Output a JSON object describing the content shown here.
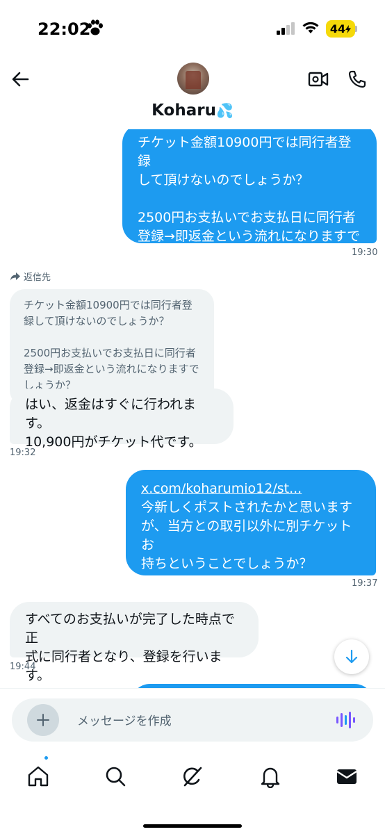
{
  "status": {
    "time": "22:02",
    "battery": "44"
  },
  "header": {
    "contact_name": "Koharu",
    "emoji": "💦"
  },
  "messages": {
    "m1": "チケット金額10900円では同行者登録\nして頂けないのでしょうか？\n\n2500円お支払いでお支払日に同行者\n登録→即返金という流れになりますで\nしょうか？",
    "m1_time": "19:30",
    "reply_label": "返信先",
    "quote": "チケット金額10900円では同行者登\n録して頂けないのでしょうか？\n\n2500円お支払いでお支払日に同行者\n登録→即返金という流れになりますで\nしょうか？",
    "m2": "はい、返金はすぐに行われます。\n10,900円がチケット代です。",
    "m2_time": "19:32",
    "m3_link1": "x.com/koharumio12/st...",
    "m3_text": "今新しくポストされたかと思います\nが、当方との取引以外に別チケットお\n持ちということでしょうか？ ",
    "m3_link2a": "x.com/",
    "m3_link2b": "KoharuMio12/st...",
    "m3_time": "19:37",
    "m4": "すべてのお支払いが完了した時点で正\n式に同行者となり、登録を行います。",
    "m4_time": "19:44"
  },
  "composer": {
    "placeholder": "メッセージを作成"
  },
  "colors": {
    "accent": "#1d9bf0",
    "received_bg": "#eff3f4",
    "battery": "#f5d90a"
  },
  "icons": [
    "back-arrow-icon",
    "video-call-icon",
    "phone-call-icon",
    "plus-icon",
    "voice-icon",
    "home-icon",
    "search-icon",
    "grok-icon",
    "bell-icon",
    "mail-icon",
    "scroll-down-icon"
  ]
}
